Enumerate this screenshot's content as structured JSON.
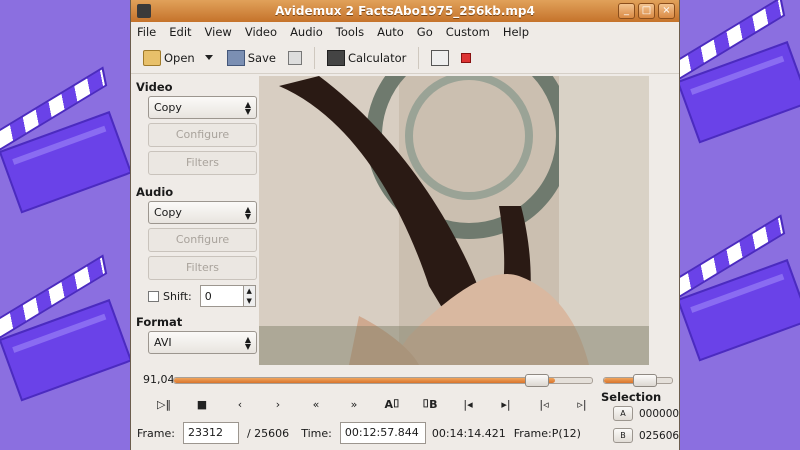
{
  "window": {
    "title": "Avidemux 2 FactsAbo1975_256kb.mp4",
    "controls": [
      "_",
      "□",
      "×"
    ]
  },
  "menu": [
    "File",
    "Edit",
    "View",
    "Video",
    "Audio",
    "Tools",
    "Auto",
    "Go",
    "Custom",
    "Help"
  ],
  "toolbar": {
    "open_label": "Open",
    "save_label": "Save",
    "calculator_label": "Calculator"
  },
  "video": {
    "label": "Video",
    "codec": "Copy",
    "configure_label": "Configure",
    "filters_label": "Filters"
  },
  "audio": {
    "label": "Audio",
    "codec": "Copy",
    "configure_label": "Configure",
    "filters_label": "Filters",
    "shift_label": "Shift:",
    "shift_value": "0"
  },
  "format": {
    "label": "Format",
    "container": "AVI"
  },
  "timeline": {
    "position_value": "91,04",
    "position_percent": 91.04,
    "volume_percent": 60
  },
  "controls": {
    "a_label": "A",
    "b_label": "B"
  },
  "status": {
    "frame_label": "Frame:",
    "frame_value": "23312",
    "total_frames": "/ 25606",
    "time_label": "Time:",
    "time_value": "00:12:57.844",
    "total_time": "00:14:14.421",
    "frame_type": "Frame:P(12)"
  },
  "selection": {
    "label": "Selection",
    "a_button": "A",
    "a_value": "000000",
    "b_button": "B",
    "b_value": "025606"
  }
}
